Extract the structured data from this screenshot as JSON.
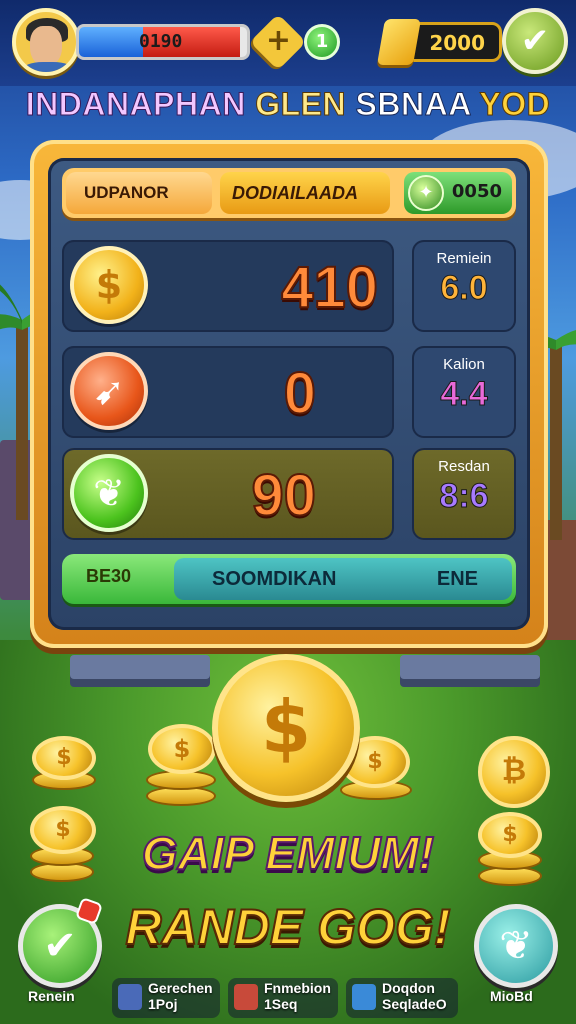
{
  "topbar": {
    "health_value": "0190",
    "health_fraction": 0.96,
    "plus_label": "+",
    "level_value": "1",
    "coins_value": "2000"
  },
  "headline": {
    "word1": "INDANAPHAN",
    "word2": "GLEN",
    "word3": "SBNAA",
    "word4": "YOD"
  },
  "panel": {
    "tabs": {
      "tab1": "UDPANOR",
      "tab2": "DODIAILAADA",
      "tab3_value": "0050"
    },
    "rows": [
      {
        "value": "410",
        "side_label": "Remiein",
        "side_value": "6.0"
      },
      {
        "value": "0",
        "side_label": "Kalion",
        "side_value": "4.4"
      },
      {
        "value": "90",
        "side_label": "Resdan",
        "side_value": "8:6"
      }
    ],
    "footer": {
      "left": "BE30",
      "middle": "SOOMDIKAN",
      "right": "ENE"
    }
  },
  "promo": {
    "line1": "GAIP EMIUM!",
    "line2": "RANDE GOG!"
  },
  "bottom_nav": {
    "item1_label": "Renein",
    "item2_line1": "Gerechen",
    "item2_line2": "1Poj",
    "item3_line1": "Fnmebion",
    "item3_line2": "1Seq",
    "item4_line1": "Doqdon",
    "item4_line2": "SeqladeO",
    "item5_label": "MioBd"
  },
  "colors": {
    "panel_frame": "#f8b73a",
    "panel_inner": "#2b4266",
    "value_orange": "#ff8a3a",
    "promo_yellow": "#ffd23a"
  },
  "icons": {
    "coin1": "dollar-coin-icon",
    "coin2": "flame-coin-icon",
    "coin3": "leaf-coin-icon",
    "confirm": "checkmark-icon"
  }
}
